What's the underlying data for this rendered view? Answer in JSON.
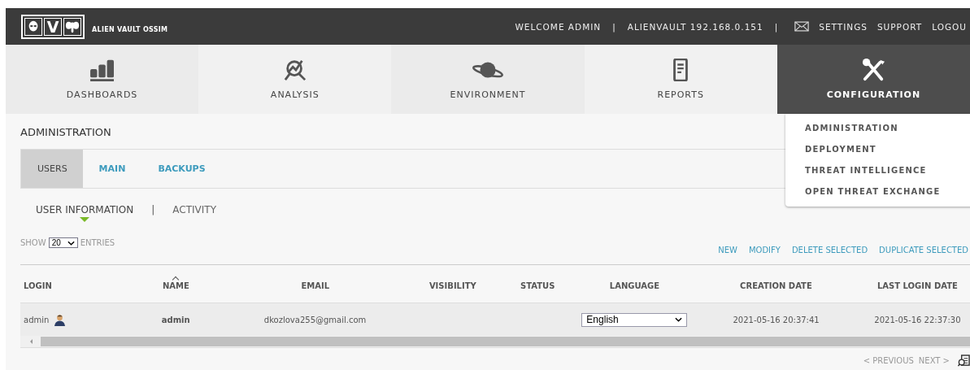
{
  "top_bar": {
    "logo_letter": "V",
    "brand": "ALIEN VAULT OSSIM",
    "links": [
      {
        "kind": "text",
        "label": "WELCOME ADMIN"
      },
      {
        "kind": "sep",
        "label": "|"
      },
      {
        "kind": "text",
        "label": "ALIENVAULT 192.168.0.151"
      },
      {
        "kind": "sep",
        "label": "|"
      },
      {
        "kind": "mail"
      },
      {
        "kind": "link",
        "label": "SETTINGS"
      },
      {
        "kind": "link",
        "label": "SUPPORT"
      },
      {
        "kind": "link",
        "label": "LOGOU"
      }
    ]
  },
  "nav": [
    {
      "label": "DASHBOARDS",
      "selected": false
    },
    {
      "label": "ANALYSIS",
      "selected": false
    },
    {
      "label": "ENVIRONMENT",
      "selected": false
    },
    {
      "label": "REPORTS",
      "selected": false
    },
    {
      "label": "CONFIGURATION",
      "selected": true
    }
  ],
  "dropdown": [
    "ADMINISTRATION",
    "DEPLOYMENT",
    "THREAT INTELLIGENCE",
    "OPEN THREAT EXCHANGE"
  ],
  "section_title": "ADMINISTRATION",
  "tabs": [
    {
      "label": "USERS",
      "selected": true
    },
    {
      "label": "MAIN",
      "selected": false
    },
    {
      "label": "BACKUPS",
      "selected": false
    }
  ],
  "subtabs": [
    {
      "label": "USER INFORMATION",
      "selected": true
    },
    {
      "label": "ACTIVITY",
      "selected": false
    }
  ],
  "subtab_separator": "|",
  "entries": {
    "show": "SHOW",
    "value": "20",
    "suffix": "ENTRIES"
  },
  "actions": [
    "NEW",
    "MODIFY",
    "DELETE SELECTED",
    "DUPLICATE SELECTED"
  ],
  "table": {
    "columns": [
      {
        "label": "LOGIN",
        "sorted": false
      },
      {
        "label": "NAME",
        "sorted": true
      },
      {
        "label": "EMAIL",
        "sorted": false
      },
      {
        "label": "VISIBILITY",
        "sorted": false
      },
      {
        "label": "STATUS",
        "sorted": false
      },
      {
        "label": "LANGUAGE",
        "sorted": false
      },
      {
        "label": "CREATION DATE",
        "sorted": false
      },
      {
        "label": "LAST LOGIN DATE",
        "sorted": false
      }
    ],
    "rows": [
      {
        "login": "admin",
        "name": "admin",
        "email": "dkozlova255@gmail.com",
        "language": "English",
        "creation_date": "2021-05-16 20:37:41",
        "last_login_date": "2021-05-16 22:37:30"
      }
    ]
  },
  "pager": {
    "previous": "< PREVIOUS",
    "next": "NEXT >",
    "disabled": true
  }
}
